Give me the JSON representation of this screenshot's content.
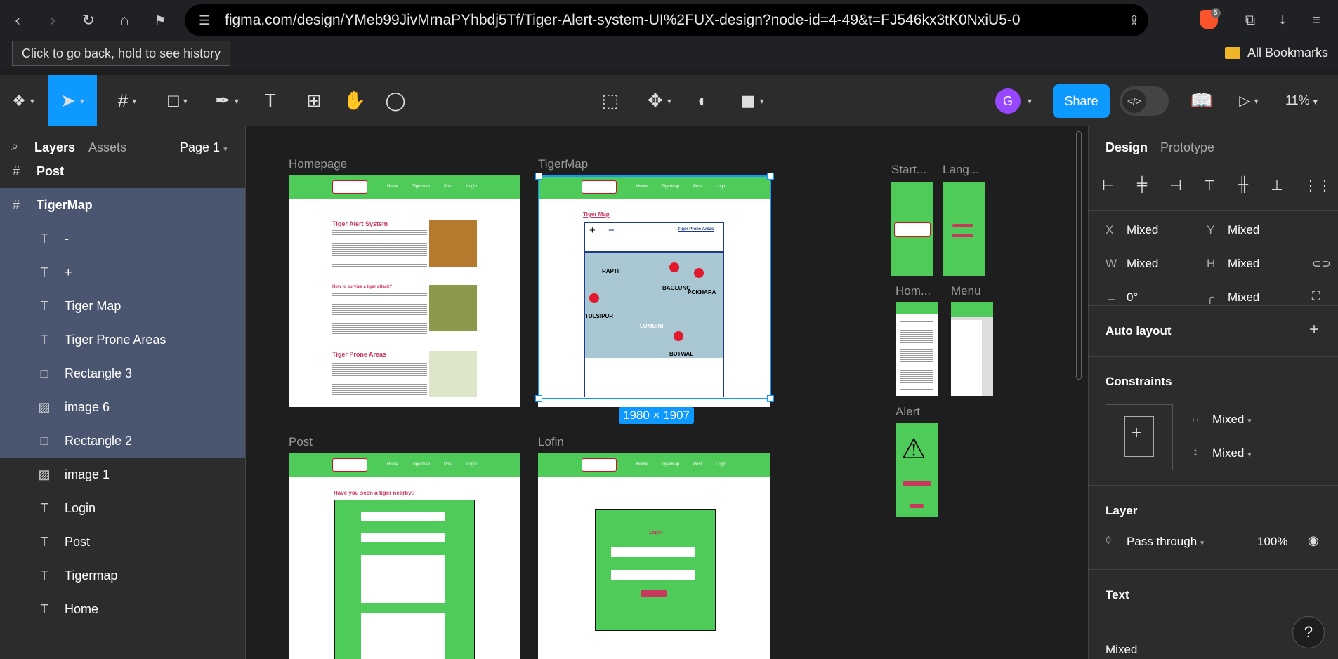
{
  "browser": {
    "url": "figma.com/design/YMeb99JivMrnaPYhbdj5Tf/Tiger-Alert-system-UI%2FUX-design?node-id=4-49&t=FJ546kx3tK0NxiU5-0",
    "tooltip": "Click to go back, hold to see history",
    "bookmarks_label": "All Bookmarks",
    "extension_badge": "5"
  },
  "toolbar": {
    "avatar_initial": "G",
    "share_label": "Share",
    "dev_mode_icon": "</>",
    "zoom": "11%"
  },
  "left_panel": {
    "tabs": {
      "layers": "Layers",
      "assets": "Assets",
      "page": "Page 1"
    },
    "layers": [
      {
        "label": "Post",
        "icon": "frame-icon",
        "glyph": "#",
        "selected": false,
        "bold": true,
        "indent": false
      },
      {
        "label": "TigerMap",
        "icon": "frame-icon",
        "glyph": "#",
        "selected": true,
        "bold": true,
        "indent": false
      },
      {
        "label": "-",
        "icon": "text-icon",
        "glyph": "T",
        "selected": true,
        "bold": false,
        "indent": true
      },
      {
        "label": "+",
        "icon": "text-icon",
        "glyph": "T",
        "selected": true,
        "bold": false,
        "indent": true
      },
      {
        "label": "Tiger Map",
        "icon": "text-icon",
        "glyph": "T",
        "selected": true,
        "bold": false,
        "indent": true
      },
      {
        "label": "Tiger Prone Areas",
        "icon": "text-icon",
        "glyph": "T",
        "selected": true,
        "bold": false,
        "indent": true
      },
      {
        "label": "Rectangle 3",
        "icon": "rectangle-icon",
        "glyph": "□",
        "selected": true,
        "bold": false,
        "indent": true
      },
      {
        "label": "image 6",
        "icon": "image-icon",
        "glyph": "▨",
        "selected": true,
        "bold": false,
        "indent": true
      },
      {
        "label": "Rectangle 2",
        "icon": "rectangle-icon",
        "glyph": "□",
        "selected": true,
        "bold": false,
        "indent": true
      },
      {
        "label": "image 1",
        "icon": "image-icon",
        "glyph": "▨",
        "selected": false,
        "bold": false,
        "indent": true
      },
      {
        "label": "Login",
        "icon": "text-icon",
        "glyph": "T",
        "selected": false,
        "bold": false,
        "indent": true
      },
      {
        "label": "Post",
        "icon": "text-icon",
        "glyph": "T",
        "selected": false,
        "bold": false,
        "indent": true
      },
      {
        "label": "Tigermap",
        "icon": "text-icon",
        "glyph": "T",
        "selected": false,
        "bold": false,
        "indent": true
      },
      {
        "label": "Home",
        "icon": "text-icon",
        "glyph": "T",
        "selected": false,
        "bold": false,
        "indent": true
      }
    ]
  },
  "canvas": {
    "frames": {
      "homepage": "Homepage",
      "tigermap": "TigerMap",
      "post": "Post",
      "lofin": "Lofin",
      "start": "Start...",
      "lang": "Lang...",
      "hom": "Hom...",
      "menu": "Menu",
      "alert": "Alert"
    },
    "homepage_sections": [
      "Tiger Alert System",
      "How to survive a tiger attack?",
      "Tiger Prone Areas"
    ],
    "map": {
      "title": "Tiger Map",
      "legend": "Tiger Prone Areas",
      "zoom_in": "+",
      "zoom_out": "−",
      "places": [
        "RAPTI",
        "BAGLUNG",
        "POKHARA",
        "TULSIPUR",
        "LUMBINI",
        "BUTWAL"
      ]
    },
    "post_heading": "Have you seen a tiger nearby?",
    "login_heading": "Login",
    "nav_links": [
      "Home",
      "Tigermap",
      "Post",
      "Login"
    ],
    "selection_size": "1980 × 1907"
  },
  "right_panel": {
    "tabs": {
      "design": "Design",
      "prototype": "Prototype"
    },
    "props": {
      "x_label": "X",
      "x_value": "Mixed",
      "y_label": "Y",
      "y_value": "Mixed",
      "w_label": "W",
      "w_value": "Mixed",
      "h_label": "H",
      "h_value": "Mixed",
      "rotation": "0°",
      "radius": "Mixed"
    },
    "auto_layout": "Auto layout",
    "constraints": {
      "title": "Constraints",
      "horizontal": "Mixed",
      "vertical": "Mixed"
    },
    "layer": {
      "title": "Layer",
      "blend": "Pass through",
      "opacity": "100%"
    },
    "text": {
      "title": "Text",
      "value": "Mixed"
    }
  },
  "colors": {
    "accent": "#0d99ff",
    "frame_green": "#4fcb5a",
    "brand_pink": "#c8385f"
  }
}
